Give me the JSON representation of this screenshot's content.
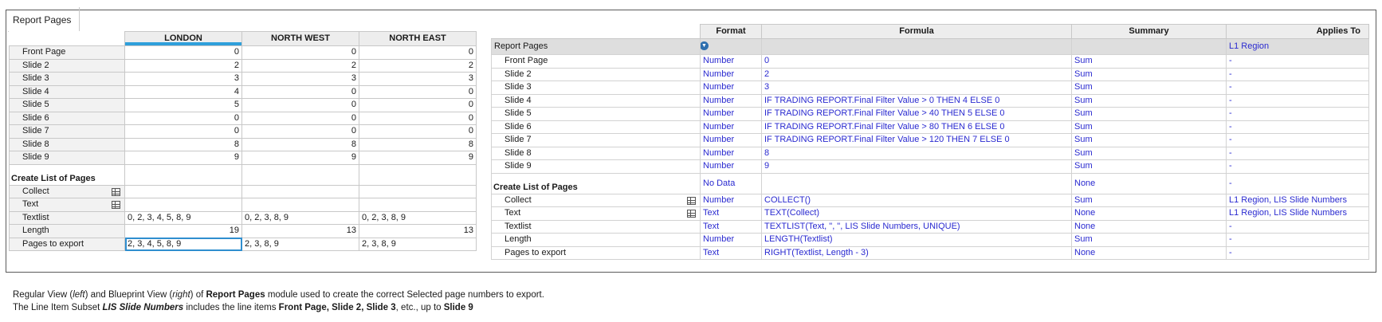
{
  "tab": {
    "label": "Report Pages"
  },
  "left": {
    "columns": [
      "LONDON",
      "NORTH WEST",
      "NORTH EAST"
    ],
    "rows": [
      {
        "label": "Front Page",
        "values": [
          "0",
          "0",
          "0"
        ]
      },
      {
        "label": "Slide 2",
        "values": [
          "2",
          "2",
          "2"
        ]
      },
      {
        "label": "Slide 3",
        "values": [
          "3",
          "3",
          "3"
        ]
      },
      {
        "label": "Slide 4",
        "values": [
          "4",
          "0",
          "0"
        ]
      },
      {
        "label": "Slide 5",
        "values": [
          "5",
          "0",
          "0"
        ]
      },
      {
        "label": "Slide 6",
        "values": [
          "0",
          "0",
          "0"
        ]
      },
      {
        "label": "Slide 7",
        "values": [
          "0",
          "0",
          "0"
        ]
      },
      {
        "label": "Slide 8",
        "values": [
          "8",
          "8",
          "8"
        ]
      },
      {
        "label": "Slide 9",
        "values": [
          "9",
          "9",
          "9"
        ]
      }
    ],
    "section_label": "Create List of Pages",
    "list_rows": [
      {
        "label": "Collect",
        "values": [
          "",
          "",
          ""
        ],
        "icon": "grid-icon"
      },
      {
        "label": "Text",
        "values": [
          "",
          "",
          ""
        ],
        "icon": "grid-icon"
      },
      {
        "label": "Textlist",
        "values": [
          "0, 2, 3, 4, 5, 8, 9",
          "0, 2, 3, 8, 9",
          "0, 2, 3, 8, 9"
        ]
      },
      {
        "label": "Length",
        "values": [
          "19",
          "13",
          "13"
        ]
      },
      {
        "label": "Pages to export",
        "values": [
          "2, 3, 4, 5, 8, 9",
          "2, 3, 8, 9",
          "2, 3, 8, 9"
        ]
      }
    ]
  },
  "right": {
    "columns": [
      "Format",
      "Formula",
      "Summary",
      "Applies To"
    ],
    "module_row": {
      "label": "Report Pages",
      "icon": "chevron-down-icon",
      "format": "",
      "formula": "",
      "summary": "",
      "applies": "L1 Region"
    },
    "rows": [
      {
        "label": "Front Page",
        "format": "Number",
        "formula": "0",
        "summary": "Sum",
        "applies": "-"
      },
      {
        "label": "Slide 2",
        "format": "Number",
        "formula": "2",
        "summary": "Sum",
        "applies": "-"
      },
      {
        "label": "Slide 3",
        "format": "Number",
        "formula": "3",
        "summary": "Sum",
        "applies": "-"
      },
      {
        "label": "Slide 4",
        "format": "Number",
        "formula": "IF TRADING REPORT.Final Filter Value > 0 THEN 4 ELSE 0",
        "summary": "Sum",
        "applies": "-"
      },
      {
        "label": "Slide 5",
        "format": "Number",
        "formula": "IF TRADING REPORT.Final Filter Value > 40 THEN 5 ELSE 0",
        "summary": "Sum",
        "applies": "-"
      },
      {
        "label": "Slide 6",
        "format": "Number",
        "formula": "IF TRADING REPORT.Final Filter Value > 80 THEN 6 ELSE 0",
        "summary": "Sum",
        "applies": "-"
      },
      {
        "label": "Slide 7",
        "format": "Number",
        "formula": "IF TRADING REPORT.Final Filter Value > 120 THEN 7 ELSE 0",
        "summary": "Sum",
        "applies": "-"
      },
      {
        "label": "Slide 8",
        "format": "Number",
        "formula": "8",
        "summary": "Sum",
        "applies": "-"
      },
      {
        "label": "Slide 9",
        "format": "Number",
        "formula": "9",
        "summary": "Sum",
        "applies": "-"
      }
    ],
    "section": {
      "label": "Create List of Pages",
      "format": "No Data",
      "formula": "",
      "summary": "None",
      "applies": "-"
    },
    "list_rows": [
      {
        "label": "Collect",
        "icon": "grid-icon",
        "format": "Number",
        "formula": "COLLECT()",
        "summary": "Sum",
        "applies": "L1 Region, LIS Slide Numbers"
      },
      {
        "label": "Text",
        "icon": "grid-icon",
        "format": "Text",
        "formula": "TEXT(Collect)",
        "summary": "None",
        "applies": "L1 Region, LIS Slide Numbers"
      },
      {
        "label": "Textlist",
        "format": "Text",
        "formula": "TEXTLIST(Text, \", \", LIS Slide Numbers, UNIQUE)",
        "summary": "None",
        "applies": "-"
      },
      {
        "label": "Length",
        "format": "Number",
        "formula": "LENGTH(Textlist)",
        "summary": "Sum",
        "applies": "-"
      },
      {
        "label": "Pages to export",
        "format": "Text",
        "formula": "RIGHT(Textlist, Length - 3)",
        "summary": "None",
        "applies": "-"
      }
    ]
  },
  "caption": {
    "line1_a": "Regular View (",
    "line1_left": "left",
    "line1_b": ") and Blueprint View (",
    "line1_right": "right",
    "line1_c": ") of ",
    "line1_module": "Report Pages",
    "line1_d": " module used to create the correct Selected page numbers to export.",
    "line2_a": "The Line Item Subset ",
    "line2_subset": "LIS Slide Numbers",
    "line2_b": " includes the line items ",
    "line2_items": "Front Page, Slide 2, Slide 3",
    "line2_c": ", etc., up to ",
    "line2_last": "Slide 9"
  },
  "colors": {
    "accent": "#2f9fdb",
    "formula_text": "#2a2ad0",
    "header_bg": "#ededed"
  }
}
